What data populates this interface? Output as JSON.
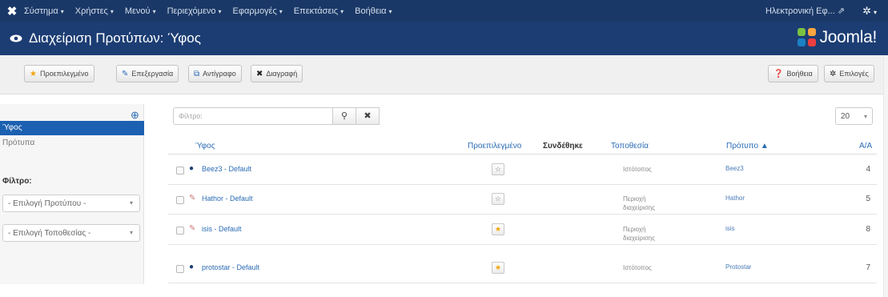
{
  "topnav": {
    "logo": "joomla-x-icon",
    "items": [
      {
        "label": "Σύστημα"
      },
      {
        "label": "Χρήστες"
      },
      {
        "label": "Μενού"
      },
      {
        "label": "Περιεχόμενο"
      },
      {
        "label": "Εφαρμογές"
      },
      {
        "label": "Επεκτάσεις"
      },
      {
        "label": "Βοήθεια"
      }
    ],
    "user": "Ηλεκτρονική Εφ... ⇗",
    "gear_caret": "▾"
  },
  "titlebar": {
    "title": "Διαχείριση Προτύπων: Ύφος",
    "brand": "Joomla!"
  },
  "toolbar": {
    "default_label": "Προεπιλεγμένο",
    "edit_label": "Επεξεργασία",
    "copy_label": "Αντίγραφο",
    "delete_label": "Διαγραφή",
    "help_label": "Βοήθεια",
    "options_label": "Επιλογές"
  },
  "sidebar": {
    "items": [
      {
        "label": "Ύφος",
        "active": true
      },
      {
        "label": "Πρότυπα",
        "active": false
      }
    ],
    "filter_title": "Φίλτρο:",
    "selects": [
      {
        "value": "- Επιλογή Προτύπου -"
      },
      {
        "value": "- Επιλογή Τοποθεσίας -"
      }
    ]
  },
  "search": {
    "placeholder": "Φίλτρο:"
  },
  "limit": {
    "value": "20"
  },
  "table": {
    "columns": {
      "style": "Ύφος",
      "default": "Προεπιλεγμένο",
      "assigned": "Συνδέθηκε",
      "location": "Τοποθεσία",
      "template": "Πρότυπο ▲",
      "id": "Α/Α"
    },
    "rows": [
      {
        "name": "Beez3 - Default",
        "location": "Ιστότοπος",
        "template": "Beez3",
        "id": "4",
        "default": false,
        "icon": "eye-icon"
      },
      {
        "name": "Hathor - Default",
        "location": "Περιοχή διαχείρισης",
        "template": "Hathor",
        "id": "5",
        "default": false,
        "icon": "pencil-icon"
      },
      {
        "name": "isis - Default",
        "location": "Περιοχή διαχείρισης",
        "template": "isis",
        "id": "8",
        "default": true,
        "icon": "pencil-icon"
      },
      {
        "name": "protostar - Default",
        "location": "Ιστότοπος",
        "template": "Protostar",
        "id": "7",
        "default": true,
        "icon": "eye-icon"
      }
    ]
  },
  "colors": {
    "nav_bg": "#1a3867",
    "title_bg": "#1c3d73",
    "accent": "#1c60b1",
    "star_active": "#f0a30a"
  }
}
